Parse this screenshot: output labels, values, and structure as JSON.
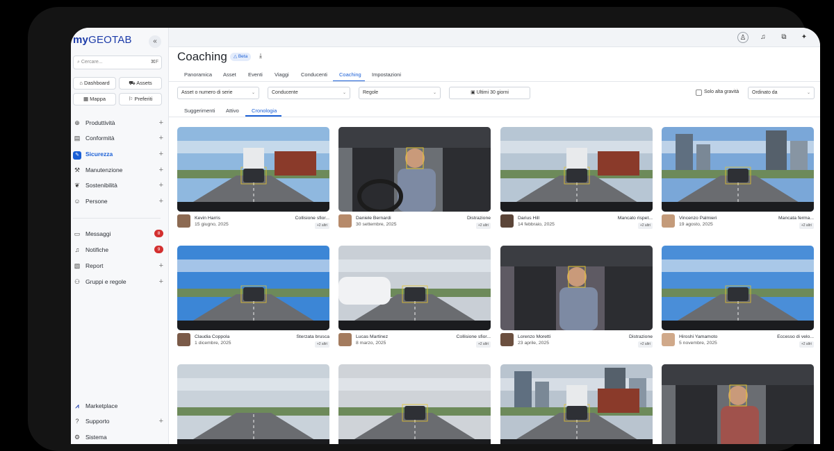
{
  "app": {
    "logo_prefix": "my",
    "logo_name": "GEOTAB"
  },
  "sidebar": {
    "search_placeholder": "Cercare...",
    "search_shortcut": "⌘F",
    "quick_links": [
      {
        "label": "Dashboard",
        "icon": "home-icon"
      },
      {
        "label": "Assets",
        "icon": "truck-icon"
      },
      {
        "label": "Mappa",
        "icon": "map-icon"
      },
      {
        "label": "Preferiti",
        "icon": "bookmark-icon"
      }
    ],
    "items": [
      {
        "label": "Produttività",
        "icon": "globe-icon"
      },
      {
        "label": "Conformità",
        "icon": "document-icon"
      },
      {
        "label": "Sicurezza",
        "icon": "shield-icon"
      },
      {
        "label": "Manutenzione",
        "icon": "wrench-icon"
      },
      {
        "label": "Sostenibilità",
        "icon": "leaf-icon"
      },
      {
        "label": "Persone",
        "icon": "people-icon"
      }
    ],
    "secondary": [
      {
        "label": "Messaggi",
        "icon": "chat-icon",
        "badge": "8"
      },
      {
        "label": "Notifiche",
        "icon": "bell-icon",
        "badge": "9"
      },
      {
        "label": "Report",
        "icon": "report-icon"
      },
      {
        "label": "Gruppi e regole",
        "icon": "hierarchy-icon"
      }
    ],
    "bottom": [
      {
        "label": "Marketplace",
        "icon": "marketplace-icon"
      },
      {
        "label": "Supporto",
        "icon": "help-icon"
      },
      {
        "label": "Sistema",
        "icon": "settings-icon"
      }
    ]
  },
  "header": {
    "title": "Coaching",
    "beta": "Beta",
    "tabs": [
      "Panoramica",
      "Asset",
      "Eventi",
      "Viaggi",
      "Conducenti",
      "Coaching",
      "Impostazioni"
    ],
    "active_tab": "Coaching"
  },
  "filters": {
    "asset": "Asset o numero di serie",
    "driver": "Conducente",
    "rules": "Regole",
    "period": "Ultimi 30 giorni",
    "high_severity": "Solo alta gravità",
    "sort": "Ordinato da"
  },
  "subtabs": [
    "Suggerimenti",
    "Attivo",
    "Cronologia"
  ],
  "active_subtab": "Cronologia",
  "cards": [
    {
      "driver": "Kevin Harris",
      "date": "15 giugno, 2025",
      "event": "Collisione sfior...",
      "more": "+2 altri",
      "scene": "road-trucks",
      "sky": "#8fb8df"
    },
    {
      "driver": "Daniele Bernardi",
      "date": "30 settembre, 2025",
      "event": "Distrazione",
      "more": "+2 altri",
      "scene": "cab-driver",
      "sky": "#6b6f74"
    },
    {
      "driver": "Darius Hill",
      "date": "14 febbraio, 2025",
      "event": "Mancato rispet...",
      "more": "+2 altri",
      "scene": "depot",
      "sky": "#b7c6d4"
    },
    {
      "driver": "Vincenzo Palmieri",
      "date": "19 agosto, 2025",
      "event": "Mancata ferma...",
      "more": "+2 altri",
      "scene": "city",
      "sky": "#7aa7d8"
    },
    {
      "driver": "Claudia Coppola",
      "date": "1 dicembre, 2025",
      "event": "Sterzata brusca",
      "more": "+2 altri",
      "scene": "open-road",
      "sky": "#3c86d6"
    },
    {
      "driver": "Lucas Martinez",
      "date": "8 marzo, 2025",
      "event": "Collisione sfior...",
      "more": "+2 altri",
      "scene": "suv",
      "sky": "#c9cfd6"
    },
    {
      "driver": "Lorenzo Moretti",
      "date": "23 aprile, 2025",
      "event": "Distrazione",
      "more": "+2 altri",
      "scene": "cab-phone",
      "sky": "#5e5a63"
    },
    {
      "driver": "Hiroshi Yamamoto",
      "date": "5 novembre, 2025",
      "event": "Eccesso di velo...",
      "more": "+2 altri",
      "scene": "highway",
      "sky": "#4a8ed8"
    },
    {
      "driver": "",
      "date": "",
      "event": "",
      "more": "",
      "scene": "rural",
      "sky": "#c9d2da"
    },
    {
      "driver": "",
      "date": "",
      "event": "",
      "more": "",
      "scene": "intersection",
      "sky": "#cfd3d8"
    },
    {
      "driver": "",
      "date": "",
      "event": "",
      "more": "",
      "scene": "city-truck",
      "sky": "#b9c4cf"
    },
    {
      "driver": "",
      "date": "",
      "event": "",
      "more": "",
      "scene": "cab-call",
      "sky": "#6a6d72"
    }
  ]
}
